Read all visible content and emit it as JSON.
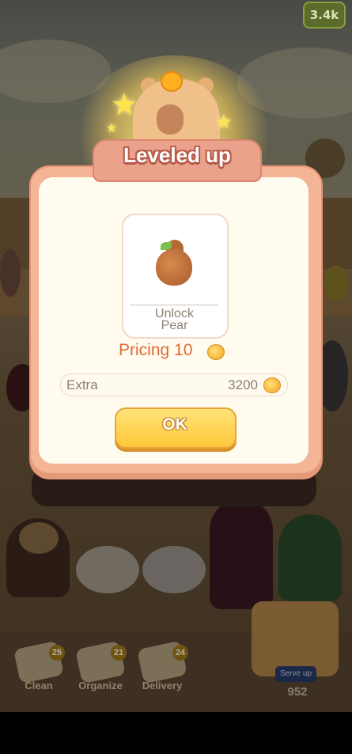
{
  "top_badge": {
    "value": "3.4k"
  },
  "dialog": {
    "title": "Leveled up",
    "unlock_label": "Unlock",
    "unlock_item": "Pear",
    "pricing_label": "Pricing 10",
    "extra_label": "Extra",
    "extra_value": "3200",
    "ok_label": "OK"
  },
  "bottom_tools": [
    {
      "label": "Clean",
      "count": "25"
    },
    {
      "label": "Organize",
      "count": "21"
    },
    {
      "label": "Delivery",
      "count": "24"
    }
  ],
  "serve": {
    "label": "Serve up",
    "count": "952"
  },
  "colors": {
    "dialog_bg": "#fffbee",
    "dialog_frame": "#f3b595",
    "accent_text": "#e06a3a",
    "button": "#ffc73a"
  }
}
